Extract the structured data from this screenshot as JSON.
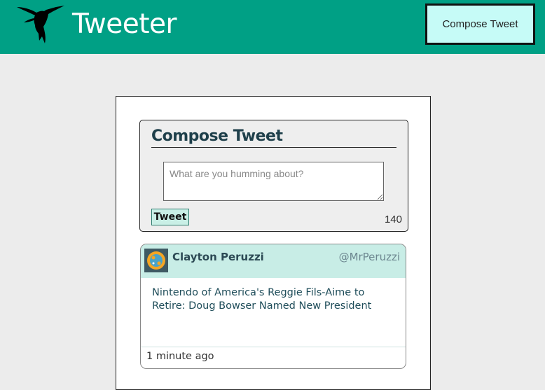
{
  "colors": {
    "nav_bg": "#00a085",
    "page_bg": "#ececec",
    "compose_button_bg": "#c6fbf7",
    "tweet_header_bg": "#c8ede6",
    "title_color": "#1e3f4a"
  },
  "nav": {
    "logo_icon": "hummingbird-icon",
    "brand": "Tweeter",
    "compose_button_label": "Compose Tweet"
  },
  "compose": {
    "title": "Compose Tweet",
    "placeholder": "What are you humming about?",
    "value": "",
    "submit_label": "Tweet",
    "counter": "140"
  },
  "tweets": [
    {
      "avatar_icon": "user-avatar-icon",
      "author": "Clayton Peruzzi",
      "handle": "@MrPeruzzi",
      "body": "Nintendo of America's Reggie Fils-Aime to Retire: Doug Bowser Named New President",
      "timestamp": "1 minute ago"
    }
  ]
}
